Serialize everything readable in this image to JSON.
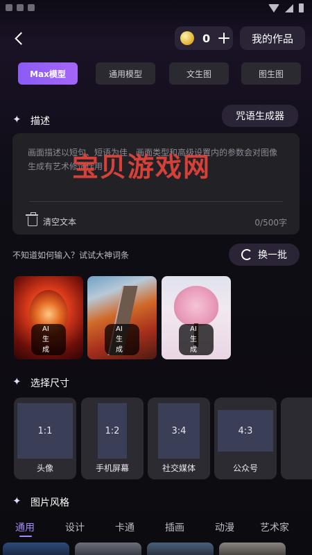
{
  "header": {
    "coins": "0",
    "my_works_label": "我的作品"
  },
  "tabs": [
    "Max模型",
    "通用模型",
    "文生图",
    "图生图"
  ],
  "describe": {
    "title": "描述",
    "spell_button": "咒语生成器",
    "placeholder": "画面描述以短句、短语为佳，画面类型和高级设置内的参数会对图像生成有艺术修饰作用",
    "clear_label": "清空文本",
    "char_count": "0/500字"
  },
  "hint": {
    "text": "不知道如何输入？试试大神词条",
    "refresh_label": "换一批"
  },
  "examples": [
    {
      "badge": "AI生成",
      "subject": "dragon"
    },
    {
      "badge": "AI生成",
      "subject": "great-wall"
    },
    {
      "badge": "AI生成",
      "subject": "pink-tree"
    }
  ],
  "size": {
    "title": "选择尺寸",
    "options": [
      {
        "ratio": "1:1",
        "label": "头像"
      },
      {
        "ratio": "1:2",
        "label": "手机屏幕"
      },
      {
        "ratio": "3:4",
        "label": "社交媒体"
      },
      {
        "ratio": "4:3",
        "label": "公众号"
      }
    ]
  },
  "style": {
    "title": "图片风格",
    "tabs": [
      "通用",
      "设计",
      "卡通",
      "插画",
      "动漫",
      "艺术家"
    ]
  },
  "watermark": "宝贝游戏网",
  "colors": {
    "accent": "#a465f7",
    "background": "#0c0c10",
    "card": "#222126"
  }
}
